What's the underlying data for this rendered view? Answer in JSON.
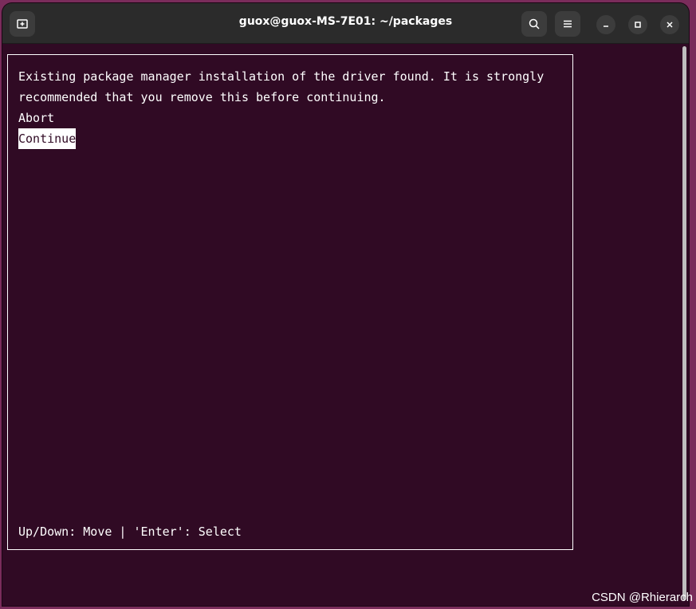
{
  "window": {
    "title": "guox@guox-MS-7E01: ~/packages"
  },
  "dialog": {
    "message_line1": "Existing package manager installation of the driver found. It is strongly",
    "message_line2": "recommended that you remove this before continuing.",
    "options": [
      {
        "label": "Abort",
        "selected": false
      },
      {
        "label": "Continue",
        "selected": true
      }
    ],
    "hint": "Up/Down: Move | 'Enter': Select"
  },
  "watermark": "CSDN @Rhierarch",
  "icons": {
    "new_tab": "new-tab-icon",
    "search": "search-icon",
    "menu": "hamburger-menu-icon",
    "minimize": "minimize-icon",
    "maximize": "maximize-icon",
    "close": "close-icon"
  },
  "colors": {
    "terminal_bg": "#300a24",
    "titlebar_bg": "#2b2b2b",
    "text": "#ffffff"
  }
}
